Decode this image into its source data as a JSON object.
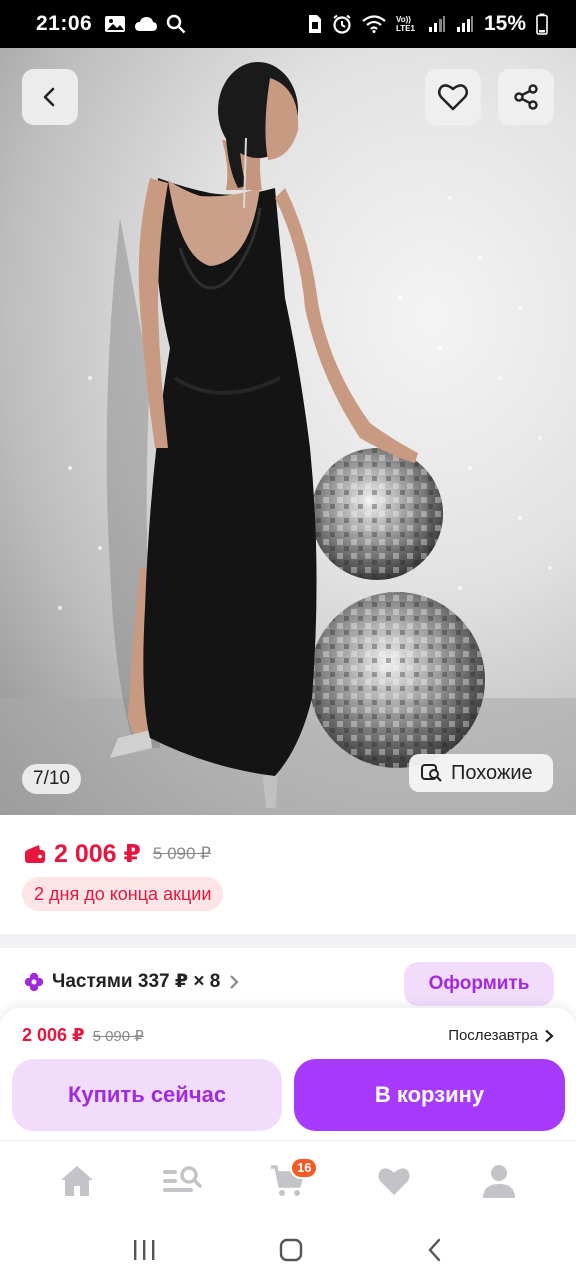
{
  "status_bar": {
    "time": "21:06",
    "left_icons": [
      "gallery-icon",
      "cloud-icon",
      "search-icon"
    ],
    "right_icons": [
      "sim-icon",
      "alarm-icon",
      "wifi-icon",
      "volte-icon",
      "signal-icon",
      "signal-icon-2"
    ],
    "volte_label": "Vo)) LTE1",
    "battery": "15%"
  },
  "gallery": {
    "counter": "7/10",
    "similar_label": "Похожие"
  },
  "price": {
    "current": "2 006 ₽",
    "old": "5 090 ₽",
    "promo": "2 дня до конца акции"
  },
  "installments": {
    "label": "Частями 337 ₽ × 8",
    "button": "Оформить"
  },
  "buy_panel": {
    "price": "2 006 ₽",
    "old_price": "5 090 ₽",
    "delivery": "Послезавтра",
    "buy_now": "Купить сейчас",
    "add_to_cart": "В корзину"
  },
  "tabbar": {
    "items": [
      "home-icon",
      "catalog-search-icon",
      "cart-icon",
      "favorites-icon",
      "profile-icon"
    ],
    "cart_badge": "16"
  },
  "colors": {
    "accent": "#a73afd",
    "accent_light": "#f2dcfb",
    "price_red": "#e5173f",
    "badge_orange": "#f55a24"
  }
}
